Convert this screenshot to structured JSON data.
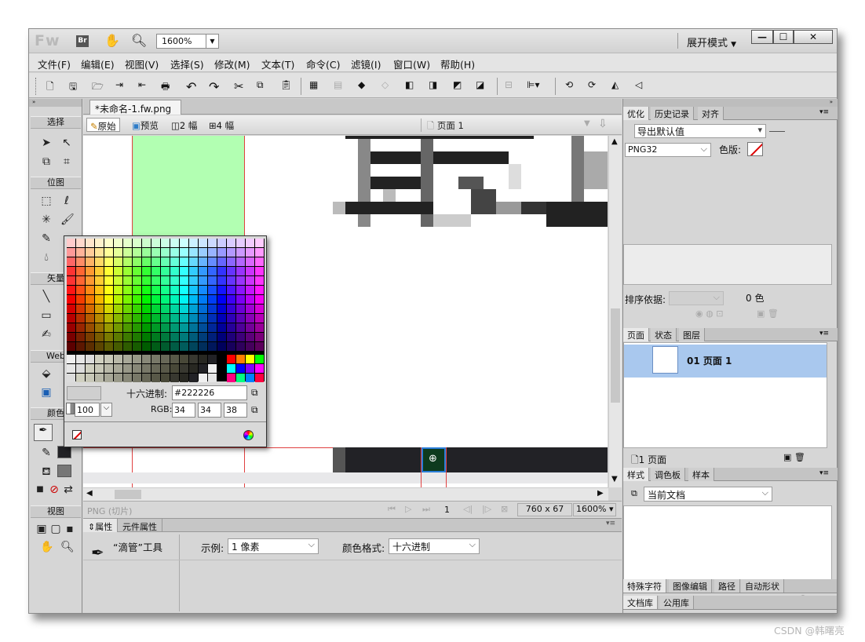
{
  "app": {
    "logo": "Fw",
    "bridge": "Br",
    "zoom": "1600%",
    "workspace": "展开模式",
    "window_buttons": [
      "—",
      "☐",
      "✕"
    ]
  },
  "menu": [
    "文件(F)",
    "编辑(E)",
    "视图(V)",
    "选择(S)",
    "修改(M)",
    "文本(T)",
    "命令(C)",
    "滤镜(I)",
    "窗口(W)",
    "帮助(H)"
  ],
  "tools": {
    "sections": [
      "选择",
      "位图",
      "矢量",
      "Web",
      "颜色",
      "视图"
    ]
  },
  "document": {
    "tab_title": "*未命名-1.fw.png",
    "tab_close": "×",
    "views": [
      "原始",
      "预览",
      "2 幅",
      "4 幅"
    ],
    "page": "页面 1"
  },
  "status": {
    "type": "PNG (切片)",
    "frame": "1",
    "size": "760 x 67",
    "zoom": "1600%"
  },
  "properties": {
    "tabs": [
      "属性",
      "元件属性"
    ],
    "tool_name": "“滴管”工具",
    "sample_label": "示例:",
    "sample_value": "1 像素",
    "color_format_label": "颜色格式:",
    "color_format_value": "十六进制"
  },
  "swatch_popup": {
    "hex_label": "十六进制:",
    "hex_value": "#222226",
    "rgb_label": "RGB:",
    "r": "34",
    "g": "34",
    "b": "38",
    "opacity": "100"
  },
  "optimize_panel": {
    "tabs": [
      "优化",
      "历史记录",
      "对齐"
    ],
    "preset": "导出默认值",
    "format": "PNG32",
    "color_label": "色版:",
    "sort_label": "排序依据:",
    "colors_count": "0 色"
  },
  "pages_panel": {
    "tabs": [
      "页面",
      "状态",
      "图层"
    ],
    "page_item": "01  页面 1",
    "footer": "1 页面"
  },
  "styles_panel": {
    "tabs": [
      "样式",
      "调色板",
      "样本"
    ],
    "scope": "当前文档"
  },
  "bottom_tabs": {
    "row1": [
      "特殊字符",
      "图像编辑",
      "路径",
      "自动形状"
    ],
    "row2": [
      "文档库",
      "公用库"
    ]
  },
  "watermark": "CSDN @韩曙亮"
}
